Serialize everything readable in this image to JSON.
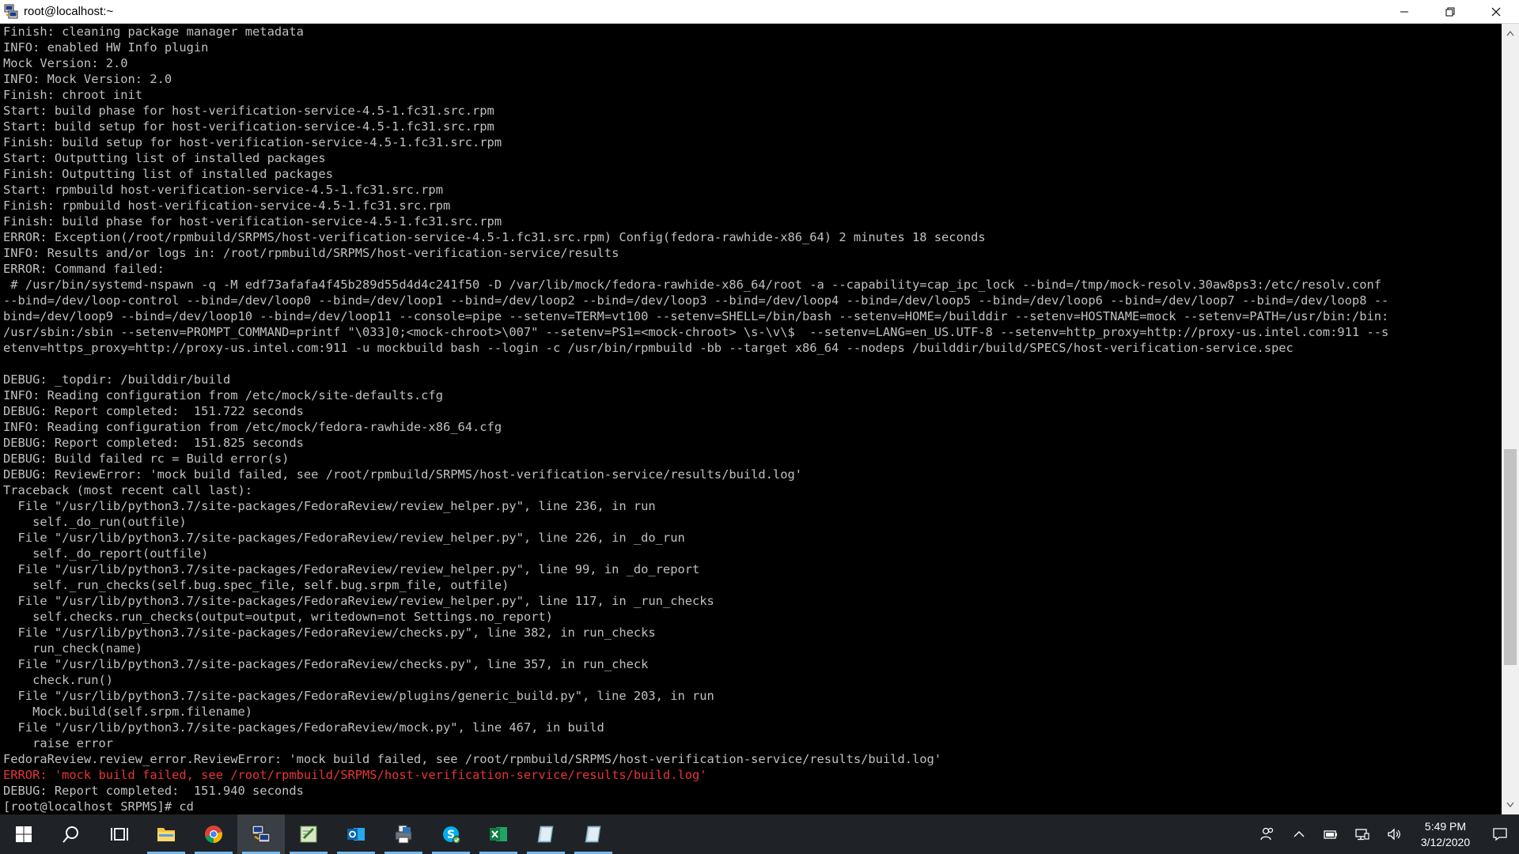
{
  "window": {
    "title": "root@localhost:~"
  },
  "terminal": {
    "lines": [
      {
        "text": "Finish: cleaning package manager metadata",
        "type": "normal"
      },
      {
        "text": "INFO: enabled HW Info plugin",
        "type": "normal"
      },
      {
        "text": "Mock Version: 2.0",
        "type": "normal"
      },
      {
        "text": "INFO: Mock Version: 2.0",
        "type": "normal"
      },
      {
        "text": "Finish: chroot init",
        "type": "normal"
      },
      {
        "text": "Start: build phase for host-verification-service-4.5-1.fc31.src.rpm",
        "type": "normal"
      },
      {
        "text": "Start: build setup for host-verification-service-4.5-1.fc31.src.rpm",
        "type": "normal"
      },
      {
        "text": "Finish: build setup for host-verification-service-4.5-1.fc31.src.rpm",
        "type": "normal"
      },
      {
        "text": "Start: Outputting list of installed packages",
        "type": "normal"
      },
      {
        "text": "Finish: Outputting list of installed packages",
        "type": "normal"
      },
      {
        "text": "Start: rpmbuild host-verification-service-4.5-1.fc31.src.rpm",
        "type": "normal"
      },
      {
        "text": "Finish: rpmbuild host-verification-service-4.5-1.fc31.src.rpm",
        "type": "normal"
      },
      {
        "text": "Finish: build phase for host-verification-service-4.5-1.fc31.src.rpm",
        "type": "normal"
      },
      {
        "text": "ERROR: Exception(/root/rpmbuild/SRPMS/host-verification-service-4.5-1.fc31.src.rpm) Config(fedora-rawhide-x86_64) 2 minutes 18 seconds",
        "type": "normal"
      },
      {
        "text": "INFO: Results and/or logs in: /root/rpmbuild/SRPMS/host-verification-service/results",
        "type": "normal"
      },
      {
        "text": "ERROR: Command failed:",
        "type": "normal"
      },
      {
        "text": " # /usr/bin/systemd-nspawn -q -M edf73afafa4f45b289d55d4d4c241f50 -D /var/lib/mock/fedora-rawhide-x86_64/root -a --capability=cap_ipc_lock --bind=/tmp/mock-resolv.30aw8ps3:/etc/resolv.conf",
        "type": "normal"
      },
      {
        "text": "--bind=/dev/loop-control --bind=/dev/loop0 --bind=/dev/loop1 --bind=/dev/loop2 --bind=/dev/loop3 --bind=/dev/loop4 --bind=/dev/loop5 --bind=/dev/loop6 --bind=/dev/loop7 --bind=/dev/loop8 --",
        "type": "normal"
      },
      {
        "text": "bind=/dev/loop9 --bind=/dev/loop10 --bind=/dev/loop11 --console=pipe --setenv=TERM=vt100 --setenv=SHELL=/bin/bash --setenv=HOME=/builddir --setenv=HOSTNAME=mock --setenv=PATH=/usr/bin:/bin:",
        "type": "normal"
      },
      {
        "text": "/usr/sbin:/sbin --setenv=PROMPT_COMMAND=printf \"\\033]0;<mock-chroot>\\007\" --setenv=PS1=<mock-chroot> \\s-\\v\\$  --setenv=LANG=en_US.UTF-8 --setenv=http_proxy=http://proxy-us.intel.com:911 --s",
        "type": "normal"
      },
      {
        "text": "etenv=https_proxy=http://proxy-us.intel.com:911 -u mockbuild bash --login -c /usr/bin/rpmbuild -bb --target x86_64 --nodeps /builddir/build/SPECS/host-verification-service.spec",
        "type": "normal"
      },
      {
        "text": "",
        "type": "normal"
      },
      {
        "text": "DEBUG: _topdir: /builddir/build",
        "type": "normal"
      },
      {
        "text": "INFO: Reading configuration from /etc/mock/site-defaults.cfg",
        "type": "normal"
      },
      {
        "text": "DEBUG: Report completed:  151.722 seconds",
        "type": "normal"
      },
      {
        "text": "INFO: Reading configuration from /etc/mock/fedora-rawhide-x86_64.cfg",
        "type": "normal"
      },
      {
        "text": "DEBUG: Report completed:  151.825 seconds",
        "type": "normal"
      },
      {
        "text": "DEBUG: Build failed rc = Build error(s)",
        "type": "normal"
      },
      {
        "text": "DEBUG: ReviewError: 'mock build failed, see /root/rpmbuild/SRPMS/host-verification-service/results/build.log'",
        "type": "normal"
      },
      {
        "text": "Traceback (most recent call last):",
        "type": "normal"
      },
      {
        "text": "  File \"/usr/lib/python3.7/site-packages/FedoraReview/review_helper.py\", line 236, in run",
        "type": "normal"
      },
      {
        "text": "    self._do_run(outfile)",
        "type": "normal"
      },
      {
        "text": "  File \"/usr/lib/python3.7/site-packages/FedoraReview/review_helper.py\", line 226, in _do_run",
        "type": "normal"
      },
      {
        "text": "    self._do_report(outfile)",
        "type": "normal"
      },
      {
        "text": "  File \"/usr/lib/python3.7/site-packages/FedoraReview/review_helper.py\", line 99, in _do_report",
        "type": "normal"
      },
      {
        "text": "    self._run_checks(self.bug.spec_file, self.bug.srpm_file, outfile)",
        "type": "normal"
      },
      {
        "text": "  File \"/usr/lib/python3.7/site-packages/FedoraReview/review_helper.py\", line 117, in _run_checks",
        "type": "normal"
      },
      {
        "text": "    self.checks.run_checks(output=output, writedown=not Settings.no_report)",
        "type": "normal"
      },
      {
        "text": "  File \"/usr/lib/python3.7/site-packages/FedoraReview/checks.py\", line 382, in run_checks",
        "type": "normal"
      },
      {
        "text": "    run_check(name)",
        "type": "normal"
      },
      {
        "text": "  File \"/usr/lib/python3.7/site-packages/FedoraReview/checks.py\", line 357, in run_check",
        "type": "normal"
      },
      {
        "text": "    check.run()",
        "type": "normal"
      },
      {
        "text": "  File \"/usr/lib/python3.7/site-packages/FedoraReview/plugins/generic_build.py\", line 203, in run",
        "type": "normal"
      },
      {
        "text": "    Mock.build(self.srpm.filename)",
        "type": "normal"
      },
      {
        "text": "  File \"/usr/lib/python3.7/site-packages/FedoraReview/mock.py\", line 467, in build",
        "type": "normal"
      },
      {
        "text": "    raise error",
        "type": "normal"
      },
      {
        "text": "FedoraReview.review_error.ReviewError: 'mock build failed, see /root/rpmbuild/SRPMS/host-verification-service/results/build.log'",
        "type": "normal"
      },
      {
        "text": "ERROR: 'mock build failed, see /root/rpmbuild/SRPMS/host-verification-service/results/build.log'",
        "type": "error"
      },
      {
        "text": "DEBUG: Report completed:  151.940 seconds",
        "type": "normal"
      },
      {
        "text": "[root@localhost SRPMS]# cd",
        "type": "normal"
      }
    ],
    "error_color": "#e83535",
    "text_color": "#c0c0c0"
  },
  "taskbar": {
    "items": [
      {
        "name": "start-button",
        "icon": "windows-logo-icon",
        "running": false,
        "active": false
      },
      {
        "name": "search-button",
        "icon": "search-icon",
        "running": false,
        "active": false
      },
      {
        "name": "task-view-button",
        "icon": "task-view-icon",
        "running": false,
        "active": false
      },
      {
        "name": "file-explorer-button",
        "icon": "folder-icon",
        "running": true,
        "active": false
      },
      {
        "name": "chrome-button",
        "icon": "chrome-icon",
        "running": true,
        "active": false
      },
      {
        "name": "putty-button",
        "icon": "putty-icon",
        "running": true,
        "active": true
      },
      {
        "name": "notepad-button",
        "icon": "notepad-icon",
        "running": true,
        "active": false
      },
      {
        "name": "outlook-button",
        "icon": "outlook-icon",
        "running": true,
        "active": false
      },
      {
        "name": "printer-app-button",
        "icon": "printer-icon",
        "running": true,
        "active": false
      },
      {
        "name": "skype-button",
        "icon": "skype-icon",
        "running": true,
        "active": false
      },
      {
        "name": "excel-button",
        "icon": "excel-icon",
        "running": true,
        "active": false
      },
      {
        "name": "app-button-1",
        "icon": "document-app-icon",
        "running": true,
        "active": false
      },
      {
        "name": "app-button-2",
        "icon": "document-app-icon",
        "running": true,
        "active": false
      }
    ],
    "clock": {
      "time": "5:49 PM",
      "date": "3/12/2020"
    },
    "accent": "#76b9ed"
  }
}
